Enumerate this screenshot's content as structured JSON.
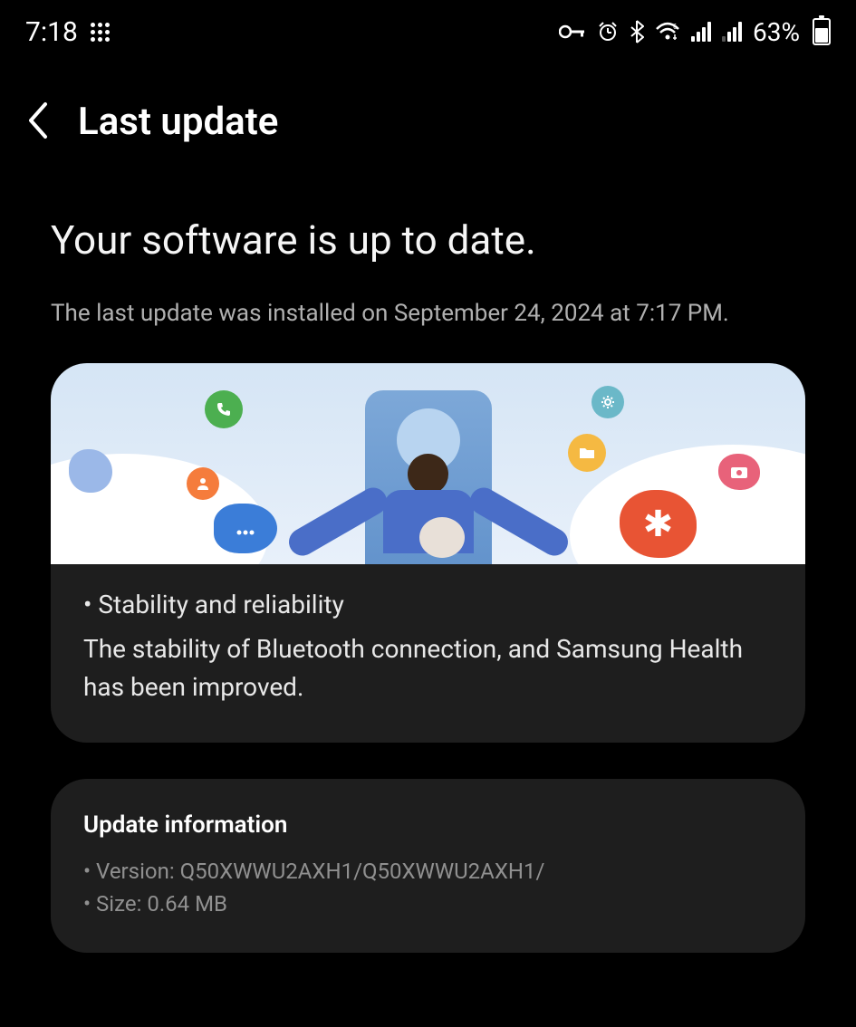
{
  "status_bar": {
    "time": "7:18",
    "battery_percent": "63%",
    "icons": {
      "vpn": "vpn-key-icon",
      "alarm": "alarm-icon",
      "bluetooth": "bluetooth-icon",
      "wifi": "wifi-icon",
      "signal1": "signal-icon",
      "signal2": "signal-icon"
    }
  },
  "header": {
    "title": "Last update"
  },
  "main": {
    "heading": "Your software is up to date.",
    "subtitle": "The last update was installed on September 24, 2024 at 7:17 PM."
  },
  "update_card": {
    "bullet_title": "• Stability and reliability",
    "bullet_desc": "The stability of Bluetooth connection, and Samsung Health has been improved."
  },
  "info_card": {
    "title": "Update information",
    "version_line": "• Version: Q50XWWU2AXH1/Q50XWWU2AXH1/",
    "size_line": "• Size: 0.64 MB"
  }
}
